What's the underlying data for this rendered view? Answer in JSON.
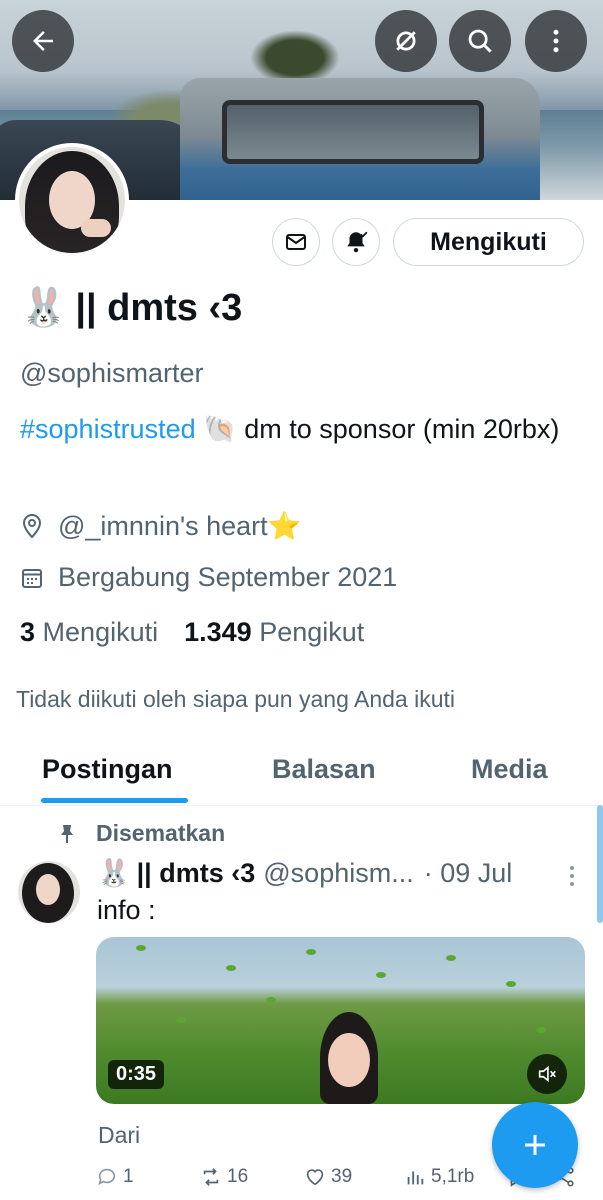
{
  "profile": {
    "name_emoji": "🐰",
    "name": "|| dmts ‹3",
    "handle": "@sophismarter",
    "bio_hashtag": "#sophistrusted",
    "bio_emoji": "🐚",
    "bio_text": " dm to sponsor (min 20rbx)",
    "location": "@_imnnin's heart⭐",
    "joined": "Bergabung September 2021",
    "following_count": "3",
    "following_label": "Mengikuti",
    "followers_count": "1.349",
    "followers_label": "Pengikut",
    "not_followed_text": "Tidak diikuti oleh siapa pun yang Anda ikuti"
  },
  "header": {
    "back_icon": "arrow-left-icon",
    "icons": [
      "muted-eye-icon",
      "search-icon",
      "more-vertical-icon"
    ]
  },
  "actions": {
    "follow_label": "Mengikuti"
  },
  "tabs": [
    {
      "label": "Postingan",
      "active": true
    },
    {
      "label": "Balasan",
      "active": false
    },
    {
      "label": "Media",
      "active": false
    }
  ],
  "post": {
    "pinned_label": "Disematkan",
    "author_emoji": "🐰",
    "author_name": "|| dmts ‹3",
    "author_handle": "@sophism...",
    "date": "· 09 Jul",
    "text": "info :",
    "video_duration": "0:35",
    "from_text": "Dari",
    "reply_count": "1",
    "repost_count": "16",
    "like_count": "39",
    "view_count": "5,1rb"
  },
  "colors": {
    "accent": "#1d9bf0",
    "text_primary": "#0f1419",
    "text_secondary": "#536471"
  }
}
